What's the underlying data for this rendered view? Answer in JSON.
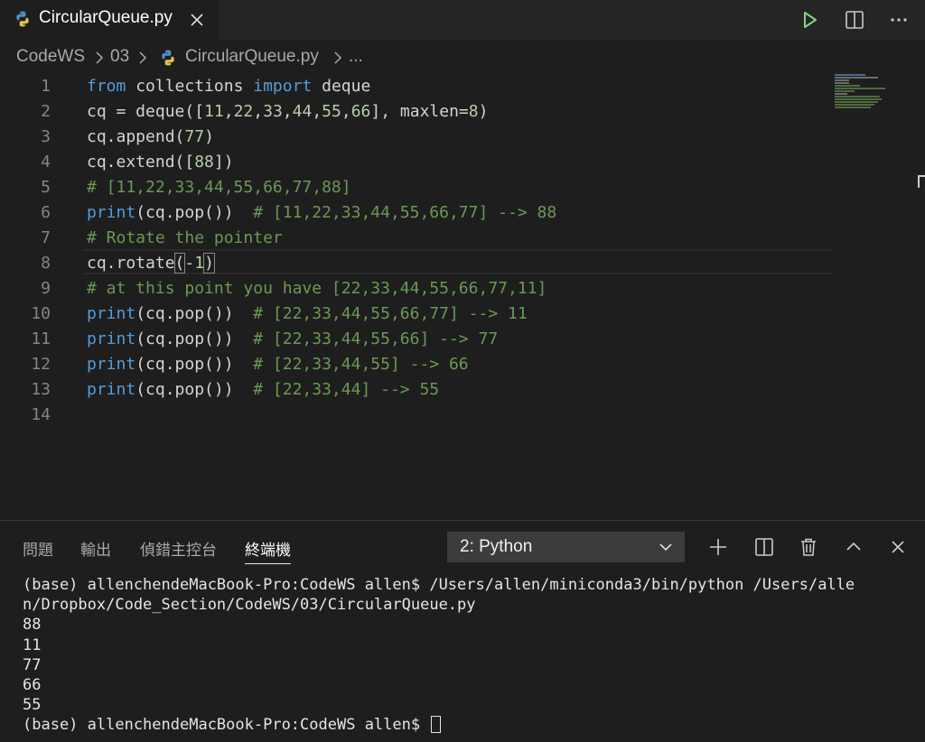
{
  "tab": {
    "title": "CircularQueue.py"
  },
  "breadcrumb": {
    "items": [
      "CodeWS",
      "03",
      "CircularQueue.py",
      "..."
    ]
  },
  "editor": {
    "line_numbers": [
      "1",
      "2",
      "3",
      "4",
      "5",
      "6",
      "7",
      "8",
      "9",
      "10",
      "11",
      "12",
      "13",
      "14"
    ],
    "lines": [
      [
        {
          "t": "from",
          "c": "kw"
        },
        {
          "t": " collections ",
          "c": ""
        },
        {
          "t": "import",
          "c": "kw"
        },
        {
          "t": " deque",
          "c": ""
        }
      ],
      [
        {
          "t": "cq = deque([",
          "c": ""
        },
        {
          "t": "11",
          "c": "num"
        },
        {
          "t": ",",
          "c": ""
        },
        {
          "t": "22",
          "c": "num"
        },
        {
          "t": ",",
          "c": ""
        },
        {
          "t": "33",
          "c": "num"
        },
        {
          "t": ",",
          "c": ""
        },
        {
          "t": "44",
          "c": "num"
        },
        {
          "t": ",",
          "c": ""
        },
        {
          "t": "55",
          "c": "num"
        },
        {
          "t": ",",
          "c": ""
        },
        {
          "t": "66",
          "c": "num"
        },
        {
          "t": "], maxlen=",
          "c": ""
        },
        {
          "t": "8",
          "c": "num"
        },
        {
          "t": ")",
          "c": ""
        }
      ],
      [
        {
          "t": "cq.append(",
          "c": ""
        },
        {
          "t": "77",
          "c": "num"
        },
        {
          "t": ")",
          "c": ""
        }
      ],
      [
        {
          "t": "cq.extend([",
          "c": ""
        },
        {
          "t": "88",
          "c": "num"
        },
        {
          "t": "])",
          "c": ""
        }
      ],
      [
        {
          "t": "# [11,22,33,44,55,66,77,88]",
          "c": "cm"
        }
      ],
      [
        {
          "t": "print",
          "c": "fn"
        },
        {
          "t": "(cq.pop())  ",
          "c": ""
        },
        {
          "t": "# [11,22,33,44,55,66,77] --> 88",
          "c": "cm"
        }
      ],
      [
        {
          "t": "# Rotate the pointer",
          "c": "cm"
        }
      ],
      [
        {
          "t": "cq.rotate",
          "c": ""
        },
        {
          "t": "(",
          "c": "br"
        },
        {
          "t": "-",
          "c": ""
        },
        {
          "t": "1",
          "c": "num"
        },
        {
          "t": ")",
          "c": "br"
        }
      ],
      [
        {
          "t": "# at this point you have [22,33,44,55,66,77,11]",
          "c": "cm"
        }
      ],
      [
        {
          "t": "print",
          "c": "fn"
        },
        {
          "t": "(cq.pop())  ",
          "c": ""
        },
        {
          "t": "# [22,33,44,55,66,77] --> 11",
          "c": "cm"
        }
      ],
      [
        {
          "t": "print",
          "c": "fn"
        },
        {
          "t": "(cq.pop())  ",
          "c": ""
        },
        {
          "t": "# [22,33,44,55,66] --> 77",
          "c": "cm"
        }
      ],
      [
        {
          "t": "print",
          "c": "fn"
        },
        {
          "t": "(cq.pop())  ",
          "c": ""
        },
        {
          "t": "# [22,33,44,55] --> 66",
          "c": "cm"
        }
      ],
      [
        {
          "t": "print",
          "c": "fn"
        },
        {
          "t": "(cq.pop())  ",
          "c": ""
        },
        {
          "t": "# [22,33,44] --> 55",
          "c": "cm"
        }
      ],
      []
    ]
  },
  "panel": {
    "tabs": [
      "問題",
      "輸出",
      "偵錯主控台",
      "終端機"
    ],
    "active_tab": "終端機",
    "terminal_selector": "2: Python"
  },
  "terminal": {
    "lines": [
      "(base) allenchendeMacBook-Pro:CodeWS allen$ /Users/allen/miniconda3/bin/python /Users/alle",
      "n/Dropbox/Code_Section/CodeWS/03/CircularQueue.py",
      "88",
      "11",
      "77",
      "66",
      "55"
    ],
    "prompt": "(base) allenchendeMacBook-Pro:CodeWS allen$ "
  },
  "colors": {
    "keyword": "#569cd6",
    "number": "#b5cea8",
    "comment": "#6a9955",
    "run_icon": "#89d185"
  }
}
